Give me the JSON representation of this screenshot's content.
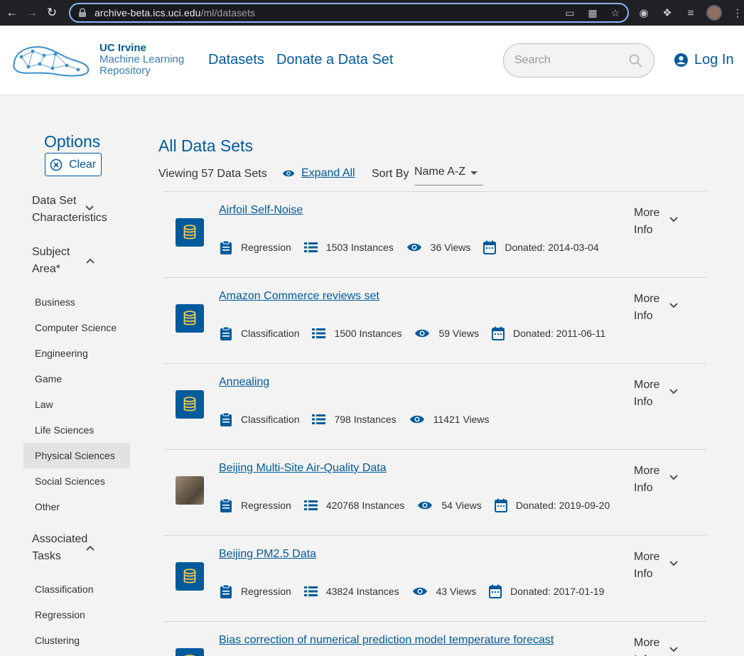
{
  "browser": {
    "url_host": "archive-beta.ics.uci.edu",
    "url_path": "/ml/datasets"
  },
  "header": {
    "logo_line1": "UC Irvine",
    "logo_line2": "Machine Learning",
    "logo_line3": "Repository",
    "nav": [
      "Datasets",
      "Donate a Data Set"
    ],
    "search_placeholder": "Search",
    "login_label": "Log In"
  },
  "sidebar": {
    "title": "Options",
    "clear_label": "Clear",
    "facets": [
      {
        "label_lines": [
          "Data Set",
          "Characteristics"
        ],
        "expanded": false
      },
      {
        "label_lines": [
          "Subject",
          "Area*"
        ],
        "expanded": true
      },
      {
        "label_lines": [
          "Associated",
          "Tasks"
        ],
        "expanded": true
      }
    ],
    "subject_items": [
      "Business",
      "Computer Science",
      "Engineering",
      "Game",
      "Law",
      "Life Sciences",
      "Physical Sciences",
      "Social Sciences",
      "Other"
    ],
    "active_subject": "Physical Sciences",
    "task_items": [
      "Classification",
      "Regression",
      "Clustering"
    ]
  },
  "main": {
    "title": "All Data Sets",
    "viewing": "Viewing 57 Data Sets",
    "expand_all": "Expand All",
    "sort_label": "Sort By",
    "sort_value": "Name A-Z",
    "more_info_line1": "More",
    "more_info_line2": "Info",
    "datasets": [
      {
        "name": "Airfoil Self-Noise",
        "task": "Regression",
        "instances": "1503 Instances",
        "views": "36 Views",
        "donated": "Donated: 2014-03-04",
        "thumb": "db-icon"
      },
      {
        "name": "Amazon Commerce reviews set",
        "task": "Classification",
        "instances": "1500 Instances",
        "views": "59 Views",
        "donated": "Donated: 2011-06-11",
        "thumb": "db-icon"
      },
      {
        "name": "Annealing",
        "task": "Classification",
        "instances": "798 Instances",
        "views": "11421 Views",
        "donated": "",
        "thumb": "db-icon"
      },
      {
        "name": "Beijing Multi-Site Air-Quality Data",
        "task": "Regression",
        "instances": "420768 Instances",
        "views": "54 Views",
        "donated": "Donated: 2019-09-20",
        "thumb": "photo"
      },
      {
        "name": "Beijing PM2.5 Data",
        "task": "Regression",
        "instances": "43824 Instances",
        "views": "43 Views",
        "donated": "Donated: 2017-01-19",
        "thumb": "db-icon"
      },
      {
        "name": "Bias correction of numerical prediction model temperature forecast",
        "task": "",
        "instances": "",
        "views": "",
        "donated": "",
        "thumb": "db-icon"
      }
    ]
  },
  "colors": {
    "brand": "#005a9c",
    "db_icon_fill": "#f2c94c"
  }
}
